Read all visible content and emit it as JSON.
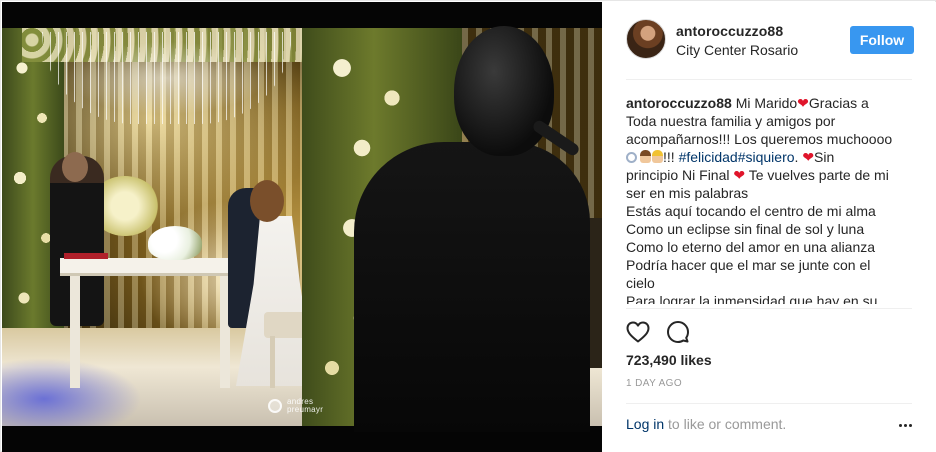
{
  "post": {
    "photo_alt": "",
    "watermark": {
      "line1": "andres",
      "line2": "preumayr"
    }
  },
  "header": {
    "username": "antoroccuzzo88",
    "location": "City Center Rosario",
    "follow_label": "Follow"
  },
  "caption": {
    "username": "antoroccuzzo88",
    "line1_text": "Mi Marido",
    "line1_after": "Gracias a",
    "line2": "Toda nuestra familia y amigos por",
    "line3": "acompañarnos!!! Los queremos muchoooo",
    "line4_after_emoji": "!!! ",
    "hashtags": "#felicidad#siquiero",
    "line4_tail": ". ",
    "line4_end": "Sin",
    "line5_text": "principio Ni Final",
    "line5_after": " Te vuelves parte de mi",
    "line6": "ser en mis palabras",
    "line7": "Estás aquí tocando el centro de mi alma",
    "line8": "Como un eclipse sin final de sol y luna",
    "line9": "Como lo eterno del amor en una alianza",
    "line10": "Podría hacer que el mar se junte con el",
    "line11": "cielo",
    "line12": "Para lograr la inmensidad que hay en su"
  },
  "actions": {
    "like_icon": "heart-outline-icon",
    "comment_icon": "comment-bubble-icon"
  },
  "likes": "723,490 likes",
  "timestamp": "1 DAY AGO",
  "comment": {
    "login_label": "Log in",
    "rest_text": " to like or comment.",
    "more_icon": "more-options-icon"
  },
  "colors": {
    "accent": "#3897f0",
    "link": "#003569",
    "heart": "#e0152b",
    "muted": "#999999"
  }
}
